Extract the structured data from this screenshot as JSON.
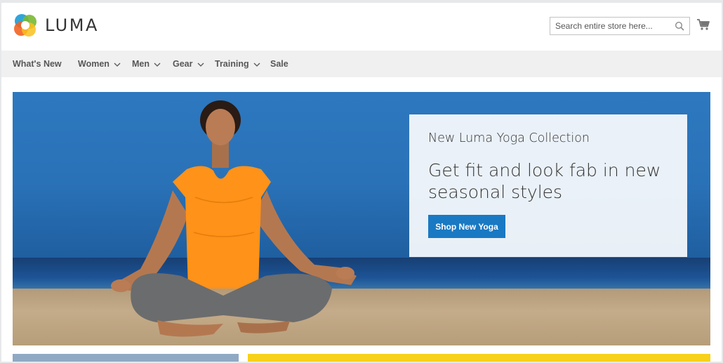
{
  "brand": {
    "name": "LUMA",
    "icon": "luma-logo-icon"
  },
  "search": {
    "placeholder": "Search entire store here...",
    "value": "",
    "icon": "search-icon"
  },
  "cart": {
    "icon": "cart-icon"
  },
  "nav": {
    "items": [
      {
        "label": "What's New",
        "has_dropdown": false
      },
      {
        "label": "Women",
        "has_dropdown": true
      },
      {
        "label": "Men",
        "has_dropdown": true
      },
      {
        "label": "Gear",
        "has_dropdown": true
      },
      {
        "label": "Training",
        "has_dropdown": true
      },
      {
        "label": "Sale",
        "has_dropdown": false
      }
    ]
  },
  "hero": {
    "subtitle": "New Luma Yoga Collection",
    "title": "Get fit and look fab in new seasonal styles",
    "button_label": "Shop New Yoga"
  },
  "colors": {
    "accent": "#1979c3",
    "nav_bg": "#f0f0f0",
    "text": "#333333",
    "banner_yellow": "#f7d11a"
  }
}
